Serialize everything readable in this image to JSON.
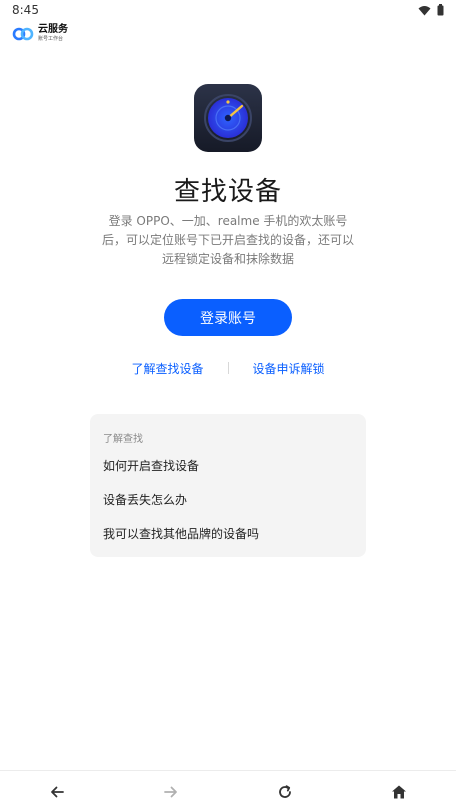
{
  "status_bar": {
    "time": "8:45",
    "icons": [
      "wifi-icon",
      "battery-icon"
    ]
  },
  "brand": {
    "name": "云服务",
    "subtitle": "账号工作台",
    "logo_icon": "cloud-infinity-logo-icon"
  },
  "hero": {
    "icon": "find-device-radar-icon",
    "title": "查找设备",
    "description": "登录 OPPO、一加、realme 手机的欢太账号后，可以定位账号下已开启查找的设备，还可以远程锁定设备和抹除数据"
  },
  "actions": {
    "login_label": "登录账号"
  },
  "links": {
    "learn_label": "了解查找设备",
    "appeal_label": "设备申诉解锁"
  },
  "faq": {
    "heading": "了解查找",
    "items": [
      "如何开启查找设备",
      "设备丢失怎么办",
      "我可以查找其他品牌的设备吗"
    ]
  },
  "bottom_nav": {
    "icons": [
      "back-arrow-icon",
      "forward-arrow-icon",
      "refresh-icon",
      "home-icon"
    ]
  },
  "colors": {
    "accent": "#0a5fff",
    "card_bg": "#f4f4f4",
    "text_secondary": "#7a7a7a"
  }
}
